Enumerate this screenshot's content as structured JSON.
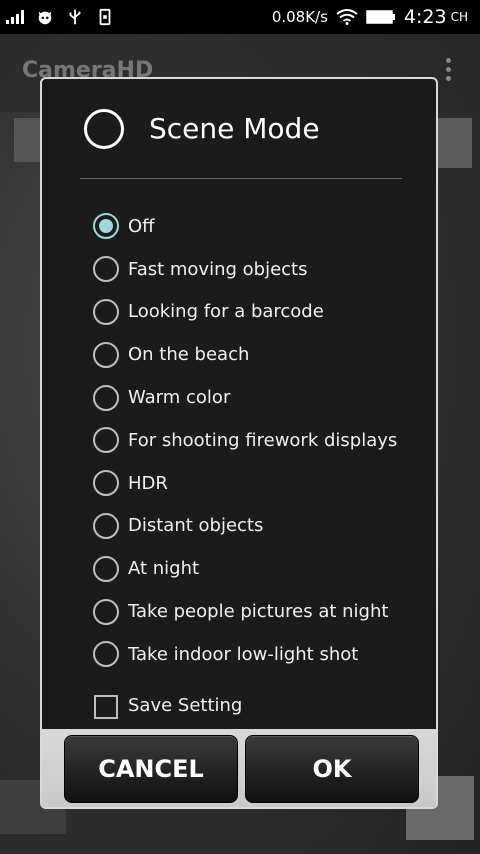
{
  "status_bar": {
    "net_speed": "0.08K/s",
    "time": "4:23",
    "time_suffix": "CH"
  },
  "background_app": {
    "title": "CameraHD"
  },
  "dialog": {
    "title": "Scene Mode",
    "options": [
      {
        "label": "Off",
        "selected": true
      },
      {
        "label": "Fast moving objects",
        "selected": false
      },
      {
        "label": "Looking for a barcode",
        "selected": false
      },
      {
        "label": "On the beach",
        "selected": false
      },
      {
        "label": "Warm color",
        "selected": false
      },
      {
        "label": "For shooting firework displays",
        "selected": false
      },
      {
        "label": "HDR",
        "selected": false
      },
      {
        "label": "Distant objects",
        "selected": false
      },
      {
        "label": "At night",
        "selected": false
      },
      {
        "label": "Take people pictures at night",
        "selected": false
      },
      {
        "label": "Take indoor low-light shot",
        "selected": false
      }
    ],
    "save_setting": {
      "label": "Save Setting",
      "checked": false
    },
    "cancel_label": "CANCEL",
    "ok_label": "OK"
  },
  "colors": {
    "accent": "#9fd7dc",
    "dialog_bg": "#1b1b1b"
  }
}
